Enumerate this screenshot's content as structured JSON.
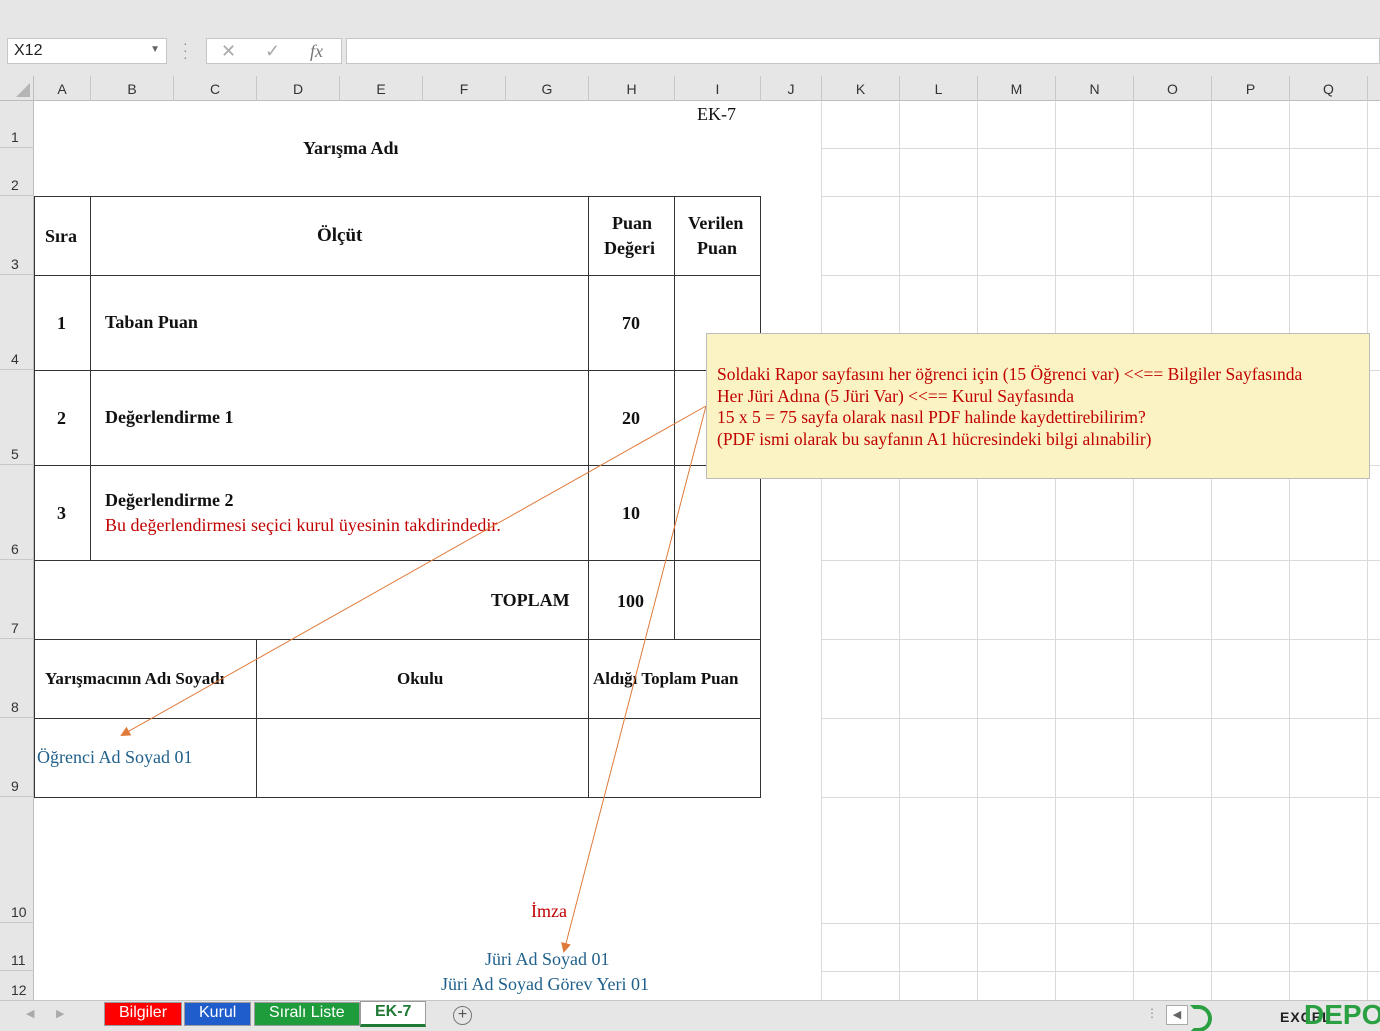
{
  "formula_bar": {
    "name_box": "X12",
    "cancel_icon": "✕",
    "enter_icon": "✓",
    "fx_label": "fx",
    "formula": ""
  },
  "columns": [
    "A",
    "B",
    "C",
    "D",
    "E",
    "F",
    "G",
    "H",
    "I",
    "J",
    "K",
    "L",
    "M",
    "N",
    "O",
    "P",
    "Q"
  ],
  "rows": [
    "1",
    "2",
    "3",
    "4",
    "5",
    "6",
    "7",
    "8",
    "9",
    "10",
    "11",
    "12"
  ],
  "sheet": {
    "ek_label": "EK-7",
    "title": "Yarışma Adı",
    "headers": {
      "sira": "Sıra",
      "olcut": "Ölçüt",
      "puan_degeri_1": "Puan",
      "puan_degeri_2": "Değeri",
      "verilen_puan_1": "Verilen",
      "verilen_puan_2": "Puan"
    },
    "criteria": [
      {
        "no": "1",
        "name": "Taban Puan",
        "note": "",
        "points": "70"
      },
      {
        "no": "2",
        "name": "Değerlendirme 1",
        "note": "",
        "points": "20"
      },
      {
        "no": "3",
        "name": "Değerlendirme 2",
        "note": "Bu değerlendirmesi seçici kurul üyesinin takdirindedir.",
        "points": "10"
      }
    ],
    "total_label": "TOPLAM",
    "total_value": "100",
    "contestant_headers": {
      "name": "Yarışmacının Adı Soyadı",
      "school": "Okulu",
      "total": "Aldığı Toplam Puan"
    },
    "contestant_name": "Öğrenci Ad Soyad 01",
    "signature_label": "İmza",
    "jury_name": "Jüri Ad Soyad 01",
    "jury_role": "Jüri Ad Soyad Görev Yeri 01"
  },
  "comment": {
    "line1": "Soldaki Rapor sayfasını her öğrenci için (15 Öğrenci var) <<== Bilgiler Sayfasında",
    "line2": "Her Jüri Adına (5 Jüri Var) <<== Kurul Sayfasında",
    "line3": "15 x 5 = 75 sayfa olarak nasıl PDF halinde kaydettirebilirim?",
    "line4": "(PDF ismi olarak bu sayfanın A1 hücresindeki bilgi alınabilir)"
  },
  "tabs": [
    {
      "label": "Bilgiler",
      "color": "#ff0000"
    },
    {
      "label": "Kurul",
      "color": "#1f5ccc"
    },
    {
      "label": "Sıralı Liste",
      "color": "#1e9b3a"
    },
    {
      "label": "EK-7",
      "color": "#ffffff",
      "active": true
    }
  ],
  "logo": {
    "prefix": "EXCEL",
    "brand": "DEPO"
  },
  "colors": {
    "accent_red": "#c00000",
    "accent_blue": "#1f5f8b",
    "comment_bg": "#fbf3c3",
    "arrow": "#e07a3a"
  }
}
